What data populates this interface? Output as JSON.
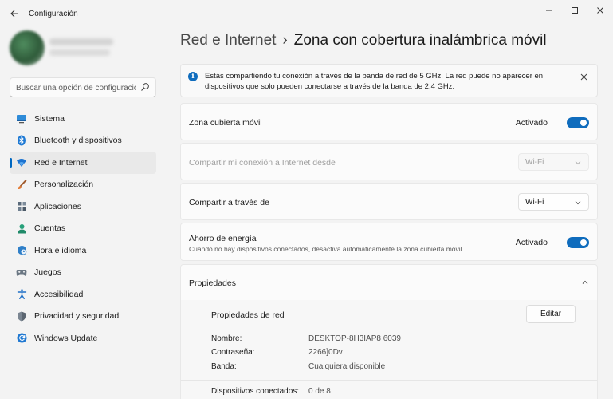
{
  "window": {
    "title": "Configuración",
    "back_icon": "back-arrow-icon",
    "minimize_icon": "minimize-icon",
    "maximize_icon": "maximize-icon",
    "close_icon": "close-icon"
  },
  "search": {
    "placeholder": "Buscar una opción de configuración",
    "icon": "search-icon"
  },
  "sidebar": {
    "items": [
      {
        "label": "Sistema",
        "icon": "monitor-icon"
      },
      {
        "label": "Bluetooth y dispositivos",
        "icon": "bluetooth-icon"
      },
      {
        "label": "Red e Internet",
        "icon": "wifi-icon"
      },
      {
        "label": "Personalización",
        "icon": "brush-icon"
      },
      {
        "label": "Aplicaciones",
        "icon": "apps-icon"
      },
      {
        "label": "Cuentas",
        "icon": "person-icon"
      },
      {
        "label": "Hora e idioma",
        "icon": "globe-clock-icon"
      },
      {
        "label": "Juegos",
        "icon": "gamepad-icon"
      },
      {
        "label": "Accesibilidad",
        "icon": "accessibility-icon"
      },
      {
        "label": "Privacidad y seguridad",
        "icon": "shield-icon"
      },
      {
        "label": "Windows Update",
        "icon": "update-icon"
      }
    ],
    "active_index": 2
  },
  "breadcrumb": {
    "parent": "Red e Internet",
    "separator": "›",
    "current": "Zona con cobertura inalámbrica móvil"
  },
  "info_bar": {
    "text": "Estás compartiendo tu conexión a través de la banda de red de 5 GHz. La red puede no aparecer en dispositivos que solo pueden conectarse a través de la banda de 2,4 GHz.",
    "icon": "info-icon",
    "close_icon": "close-icon"
  },
  "settings": {
    "hotspot": {
      "label": "Zona cubierta móvil",
      "state": "Activado",
      "on": true
    },
    "share_from": {
      "label": "Compartir mi conexión a Internet desde",
      "value": "Wi-Fi",
      "disabled": true
    },
    "share_over": {
      "label": "Compartir a través de",
      "value": "Wi-Fi"
    },
    "power_saving": {
      "label": "Ahorro de energía",
      "description": "Cuando no hay dispositivos conectados, desactiva automáticamente la zona cubierta móvil.",
      "state": "Activado",
      "on": true
    }
  },
  "properties": {
    "title": "Propiedades",
    "network_props_title": "Propiedades de red",
    "edit_label": "Editar",
    "name_label": "Nombre:",
    "name_value": "DESKTOP-8H3IAP8 6039",
    "password_label": "Contraseña:",
    "password_value": "2266]0Dv",
    "band_label": "Banda:",
    "band_value": "Cualquiera disponible",
    "connected_label": "Dispositivos conectados:",
    "connected_value": "0 de 8"
  },
  "colors": {
    "accent": "#0f6cbd",
    "background": "#f3f3f3",
    "card": "#fbfbfb"
  }
}
